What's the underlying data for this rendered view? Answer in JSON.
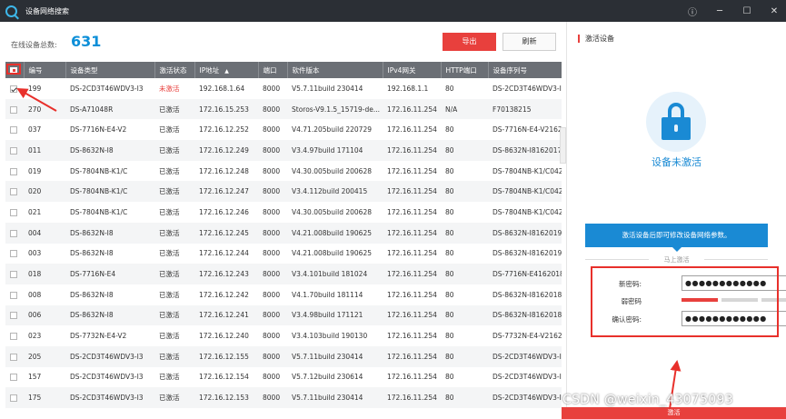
{
  "window": {
    "title": "设备网络搜索",
    "controls": [
      "ⓘ",
      "─",
      "☐",
      "✕"
    ]
  },
  "toolbar": {
    "online_label": "在线设备总数:",
    "online_count": "631",
    "export_label": "导出",
    "refresh_label": "刷新"
  },
  "table": {
    "headers": [
      "编号",
      "设备类型",
      "激活状态",
      "IP地址",
      "端口",
      "软件版本",
      "IPv4网关",
      "HTTP端口",
      "设备序列号"
    ],
    "rows": [
      [
        "199",
        "DS-2CD3T46WDV3-I3",
        "未激活",
        "192.168.1.64",
        "8000",
        "V5.7.11build 230414",
        "192.168.1.1",
        "80",
        "DS-2CD3T46WDV3-I"
      ],
      [
        "270",
        "DS-A71048R",
        "已激活",
        "172.16.15.253",
        "8000",
        "Storos-V9.1.5_15719-de...",
        "172.16.11.254",
        "N/A",
        "F70138215"
      ],
      [
        "037",
        "DS-7716N-E4-V2",
        "已激活",
        "172.16.12.252",
        "8000",
        "V4.71.205build 220729",
        "172.16.11.254",
        "80",
        "DS-7716N-E4-V2162"
      ],
      [
        "011",
        "DS-8632N-I8",
        "已激活",
        "172.16.12.249",
        "8000",
        "V3.4.97build 171104",
        "172.16.11.254",
        "80",
        "DS-8632N-I8162017"
      ],
      [
        "019",
        "DS-7804NB-K1/C",
        "已激活",
        "172.16.12.248",
        "8000",
        "V4.30.005build 200628",
        "172.16.11.254",
        "80",
        "DS-7804NB-K1/C042"
      ],
      [
        "020",
        "DS-7804NB-K1/C",
        "已激活",
        "172.16.12.247",
        "8000",
        "V3.4.112build 200415",
        "172.16.11.254",
        "80",
        "DS-7804NB-K1/C042"
      ],
      [
        "021",
        "DS-7804NB-K1/C",
        "已激活",
        "172.16.12.246",
        "8000",
        "V4.30.005build 200628",
        "172.16.11.254",
        "80",
        "DS-7804NB-K1/C042"
      ],
      [
        "004",
        "DS-8632N-I8",
        "已激活",
        "172.16.12.245",
        "8000",
        "V4.21.008build 190625",
        "172.16.11.254",
        "80",
        "DS-8632N-I8162019"
      ],
      [
        "003",
        "DS-8632N-I8",
        "已激活",
        "172.16.12.244",
        "8000",
        "V4.21.008build 190625",
        "172.16.11.254",
        "80",
        "DS-8632N-I8162019"
      ],
      [
        "018",
        "DS-7716N-E4",
        "已激活",
        "172.16.12.243",
        "8000",
        "V3.4.101build 181024",
        "172.16.11.254",
        "80",
        "DS-7716N-E4162018"
      ],
      [
        "008",
        "DS-8632N-I8",
        "已激活",
        "172.16.12.242",
        "8000",
        "V4.1.70build 181114",
        "172.16.11.254",
        "80",
        "DS-8632N-I8162018"
      ],
      [
        "006",
        "DS-8632N-I8",
        "已激活",
        "172.16.12.241",
        "8000",
        "V3.4.98build 171121",
        "172.16.11.254",
        "80",
        "DS-8632N-I8162018"
      ],
      [
        "023",
        "DS-7732N-E4-V2",
        "已激活",
        "172.16.12.240",
        "8000",
        "V3.4.103build 190130",
        "172.16.11.254",
        "80",
        "DS-7732N-E4-V2162"
      ],
      [
        "205",
        "DS-2CD3T46WDV3-I3",
        "已激活",
        "172.16.12.155",
        "8000",
        "V5.7.11build 230414",
        "172.16.11.254",
        "80",
        "DS-2CD3T46WDV3-I"
      ],
      [
        "157",
        "DS-2CD3T46WDV3-I3",
        "已激活",
        "172.16.12.154",
        "8000",
        "V5.7.12build 230614",
        "172.16.11.254",
        "80",
        "DS-2CD3T46WDV3-I"
      ],
      [
        "175",
        "DS-2CD3T46WDV3-I3",
        "已激活",
        "172.16.12.153",
        "8000",
        "V5.7.11build 230414",
        "172.16.11.254",
        "80",
        "DS-2CD3T46WDV3-I"
      ]
    ],
    "checked_row": 0
  },
  "panel": {
    "title": "激活设备",
    "status_text": "设备未激活",
    "info_text": "激活设备后即可修改设备网络参数。",
    "divider_text": "马上激活",
    "new_password_label": "新密码:",
    "new_password_value": "●●●●●●●●●●●●",
    "strength_label": "弱密码",
    "strength_level": 0.33,
    "confirm_password_label": "确认密码:",
    "confirm_password_value": "●●●●●●●●●●●●",
    "activate_label": "激活"
  },
  "watermark": "CSDN @weixin_43075093",
  "colors": {
    "titlebar": "#2b2f35",
    "accent_red": "#e8403d",
    "accent_blue": "#1a8ad4",
    "header_gray": "#6b6f75"
  }
}
